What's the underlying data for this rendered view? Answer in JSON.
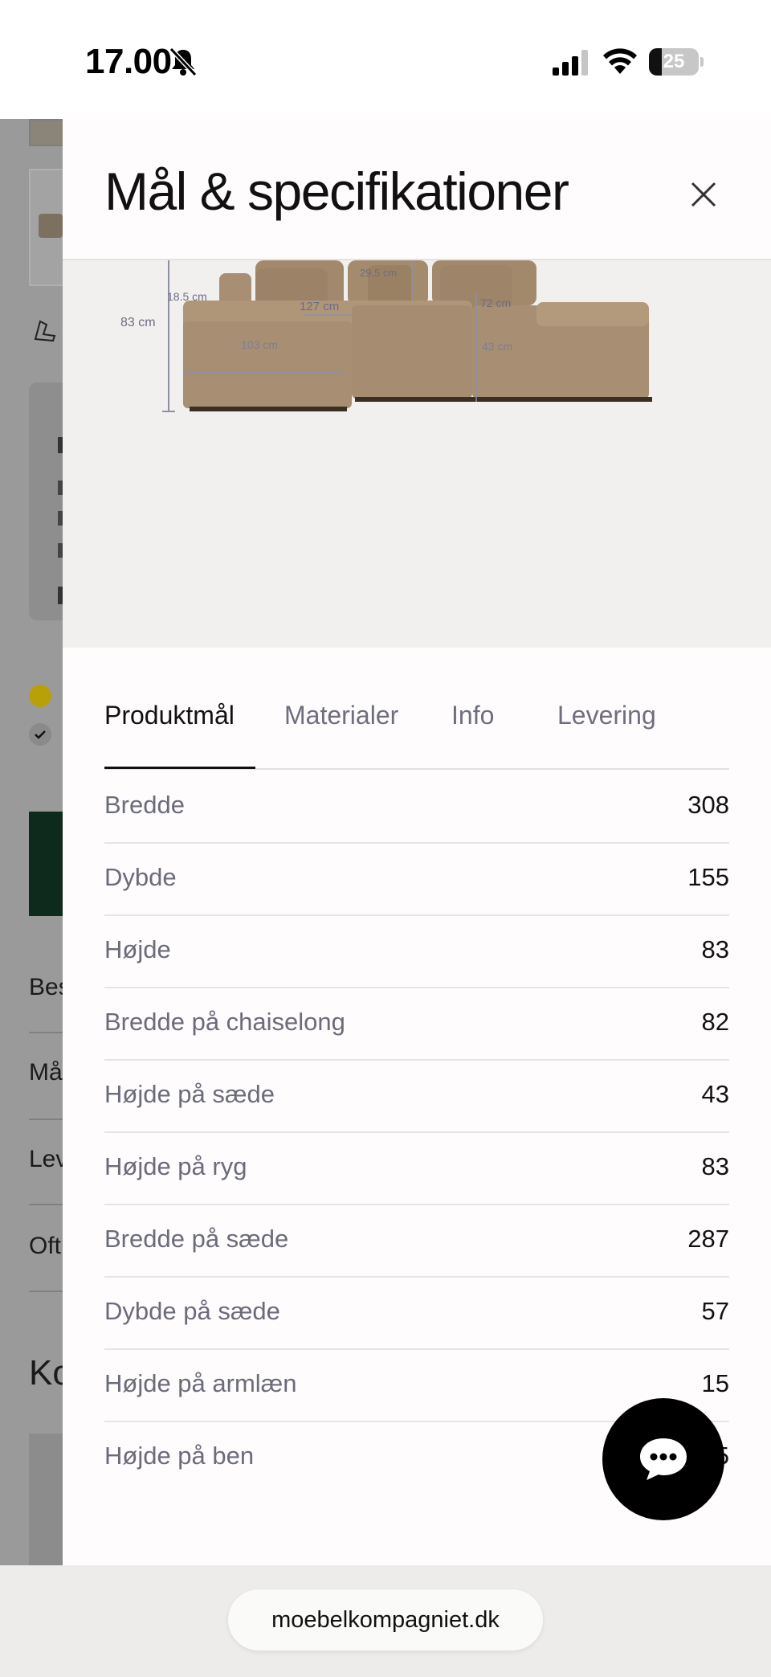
{
  "status_bar": {
    "time": "17.00",
    "battery_level": "25",
    "battery_fraction": 0.25
  },
  "background_page": {
    "labels": [
      "Bes",
      "Må",
      "Lev",
      "Oft"
    ],
    "heading": "Ko"
  },
  "sheet": {
    "title": "Mål & specifikationer",
    "close_icon": "close-icon",
    "image": {
      "dimension_labels": [
        "83 cm",
        "18.5 cm",
        "127 cm",
        "29.5 cm",
        "72 cm",
        "103 cm",
        "43 cm"
      ]
    },
    "tabs": [
      {
        "label": "Produktmål",
        "active": true
      },
      {
        "label": "Materialer",
        "active": false
      },
      {
        "label": "Info",
        "active": false
      },
      {
        "label": "Levering",
        "active": false
      }
    ],
    "specs": [
      {
        "label": "Bredde",
        "value": "308"
      },
      {
        "label": "Dybde",
        "value": "155"
      },
      {
        "label": "Højde",
        "value": "83"
      },
      {
        "label": "Bredde på chaiselong",
        "value": "82"
      },
      {
        "label": "Højde på sæde",
        "value": "43"
      },
      {
        "label": "Højde på ryg",
        "value": "83"
      },
      {
        "label": "Bredde på sæde",
        "value": "287"
      },
      {
        "label": "Dybde på sæde",
        "value": "57"
      },
      {
        "label": "Højde på armlæn",
        "value": "15"
      },
      {
        "label": "Højde på ben",
        "value": "5"
      }
    ]
  },
  "chat_button": {
    "icon": "chat-bubble-icon"
  },
  "browser": {
    "url": "moebelkompagniet.dk"
  },
  "colors": {
    "sheet_bg": "#fefcfc",
    "image_bg": "#f2f0ef",
    "overlay": "#9a9a9a",
    "sofa": "#a88e72",
    "chat_button": "#000000"
  }
}
